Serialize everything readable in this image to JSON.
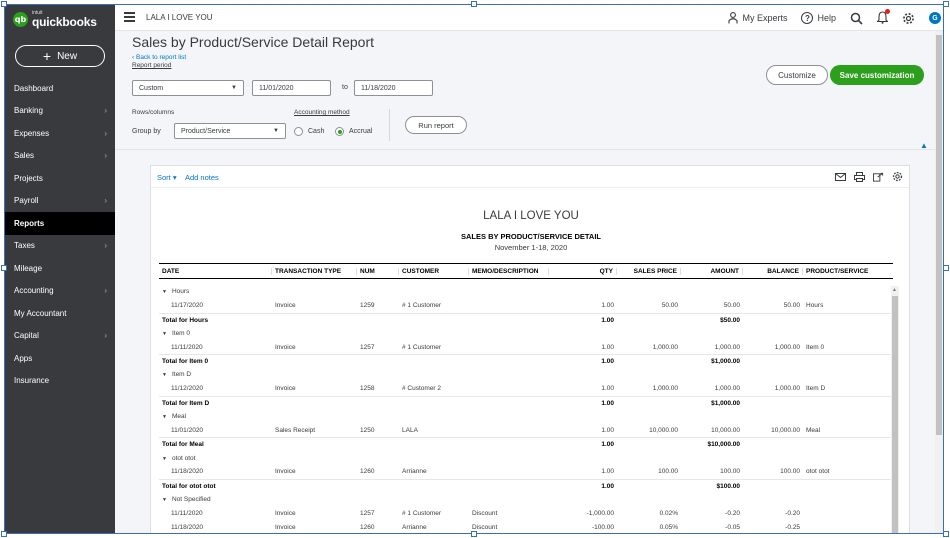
{
  "app": {
    "logo_intuit": "intuit",
    "logo_name": "quickbooks",
    "new_label": "New"
  },
  "sidebar": {
    "items": [
      {
        "label": "Dashboard",
        "chevron": false,
        "active": false
      },
      {
        "label": "Banking",
        "chevron": true,
        "active": false
      },
      {
        "label": "Expenses",
        "chevron": true,
        "active": false
      },
      {
        "label": "Sales",
        "chevron": true,
        "active": false
      },
      {
        "label": "Projects",
        "chevron": false,
        "active": false
      },
      {
        "label": "Payroll",
        "chevron": true,
        "active": false
      },
      {
        "label": "Reports",
        "chevron": false,
        "active": true
      },
      {
        "label": "Taxes",
        "chevron": true,
        "active": false
      },
      {
        "label": "Mileage",
        "chevron": false,
        "active": false
      },
      {
        "label": "Accounting",
        "chevron": true,
        "active": false
      },
      {
        "label": "My Accountant",
        "chevron": false,
        "active": false
      },
      {
        "label": "Capital",
        "chevron": true,
        "active": false
      },
      {
        "label": "Apps",
        "chevron": false,
        "active": false
      },
      {
        "label": "Insurance",
        "chevron": false,
        "active": false
      }
    ]
  },
  "topbar": {
    "company": "LALA I LOVE YOU",
    "my_experts": "My Experts",
    "help": "Help",
    "avatar_letter": "G"
  },
  "header": {
    "title": "Sales by Product/Service Detail Report",
    "back_link": "Back to report list",
    "report_period_label": "Report period",
    "period_value": "Custom",
    "from_date": "11/01/2020",
    "to_label": "to",
    "to_date": "11/18/2020",
    "rows_columns_label": "Rows/columns",
    "group_by_label": "Group by",
    "group_by_value": "Product/Service",
    "accounting_method_label": "Accounting method",
    "cash_label": "Cash",
    "accrual_label": "Accrual",
    "selected_method": "Accrual",
    "run_report": "Run report",
    "customize": "Customize",
    "save_customization": "Save customization"
  },
  "report": {
    "sort_label": "Sort",
    "add_notes": "Add notes",
    "company": "LALA I LOVE YOU",
    "title": "SALES BY PRODUCT/SERVICE DETAIL",
    "dates": "November 1-18, 2020",
    "columns": [
      "DATE",
      "TRANSACTION TYPE",
      "NUM",
      "CUSTOMER",
      "MEMO/DESCRIPTION",
      "QTY",
      "SALES PRICE",
      "AMOUNT",
      "BALANCE",
      "PRODUCT/SERVICE"
    ],
    "rows": [
      {
        "kind": "group",
        "label": "Hours"
      },
      {
        "kind": "data",
        "cells": [
          "11/17/2020",
          "Invoice",
          "1259",
          "# 1 Customer",
          "",
          "1.00",
          "50.00",
          "50.00",
          "50.00",
          "Hours"
        ]
      },
      {
        "kind": "total",
        "label": "Total for Hours",
        "qty": "1.00",
        "amount": "$50.00"
      },
      {
        "kind": "group",
        "label": "Item 0"
      },
      {
        "kind": "data",
        "cells": [
          "11/11/2020",
          "Invoice",
          "1257",
          "# 1 Customer",
          "",
          "1.00",
          "1,000.00",
          "1,000.00",
          "1,000.00",
          "Item 0"
        ]
      },
      {
        "kind": "total",
        "label": "Total for Item 0",
        "qty": "1.00",
        "amount": "$1,000.00"
      },
      {
        "kind": "group",
        "label": "Item D"
      },
      {
        "kind": "data",
        "cells": [
          "11/12/2020",
          "Invoice",
          "1258",
          "# Customer 2",
          "",
          "1.00",
          "1,000.00",
          "1,000.00",
          "1,000.00",
          "Item D"
        ]
      },
      {
        "kind": "total",
        "label": "Total for Item D",
        "qty": "1.00",
        "amount": "$1,000.00"
      },
      {
        "kind": "group",
        "label": "Meal"
      },
      {
        "kind": "data",
        "cells": [
          "11/01/2020",
          "Sales Receipt",
          "1250",
          "LALA",
          "",
          "1.00",
          "10,000.00",
          "10,000.00",
          "10,000.00",
          "Meal"
        ]
      },
      {
        "kind": "total",
        "label": "Total for Meal",
        "qty": "1.00",
        "amount": "$10,000.00"
      },
      {
        "kind": "group",
        "label": "otot otot"
      },
      {
        "kind": "data",
        "cells": [
          "11/18/2020",
          "Invoice",
          "1260",
          "Arrianne",
          "",
          "1.00",
          "100.00",
          "100.00",
          "100.00",
          "otot otot"
        ]
      },
      {
        "kind": "total",
        "label": "Total for otot otot",
        "qty": "1.00",
        "amount": "$100.00"
      },
      {
        "kind": "group",
        "label": "Not Specified"
      },
      {
        "kind": "data",
        "cells": [
          "11/11/2020",
          "Invoice",
          "1257",
          "# 1 Customer",
          "Discount",
          "-1,000.00",
          "0.02%",
          "-0.20",
          "-0.20",
          ""
        ]
      },
      {
        "kind": "data",
        "cells": [
          "11/18/2020",
          "Invoice",
          "1260",
          "Arrianne",
          "Discount",
          "-100.00",
          "0.05%",
          "-0.05",
          "-0.25",
          ""
        ]
      }
    ]
  },
  "colors": {
    "sidebar_bg": "#393a3d",
    "brand_green": "#2ca01c",
    "link_blue": "#0077c5"
  }
}
